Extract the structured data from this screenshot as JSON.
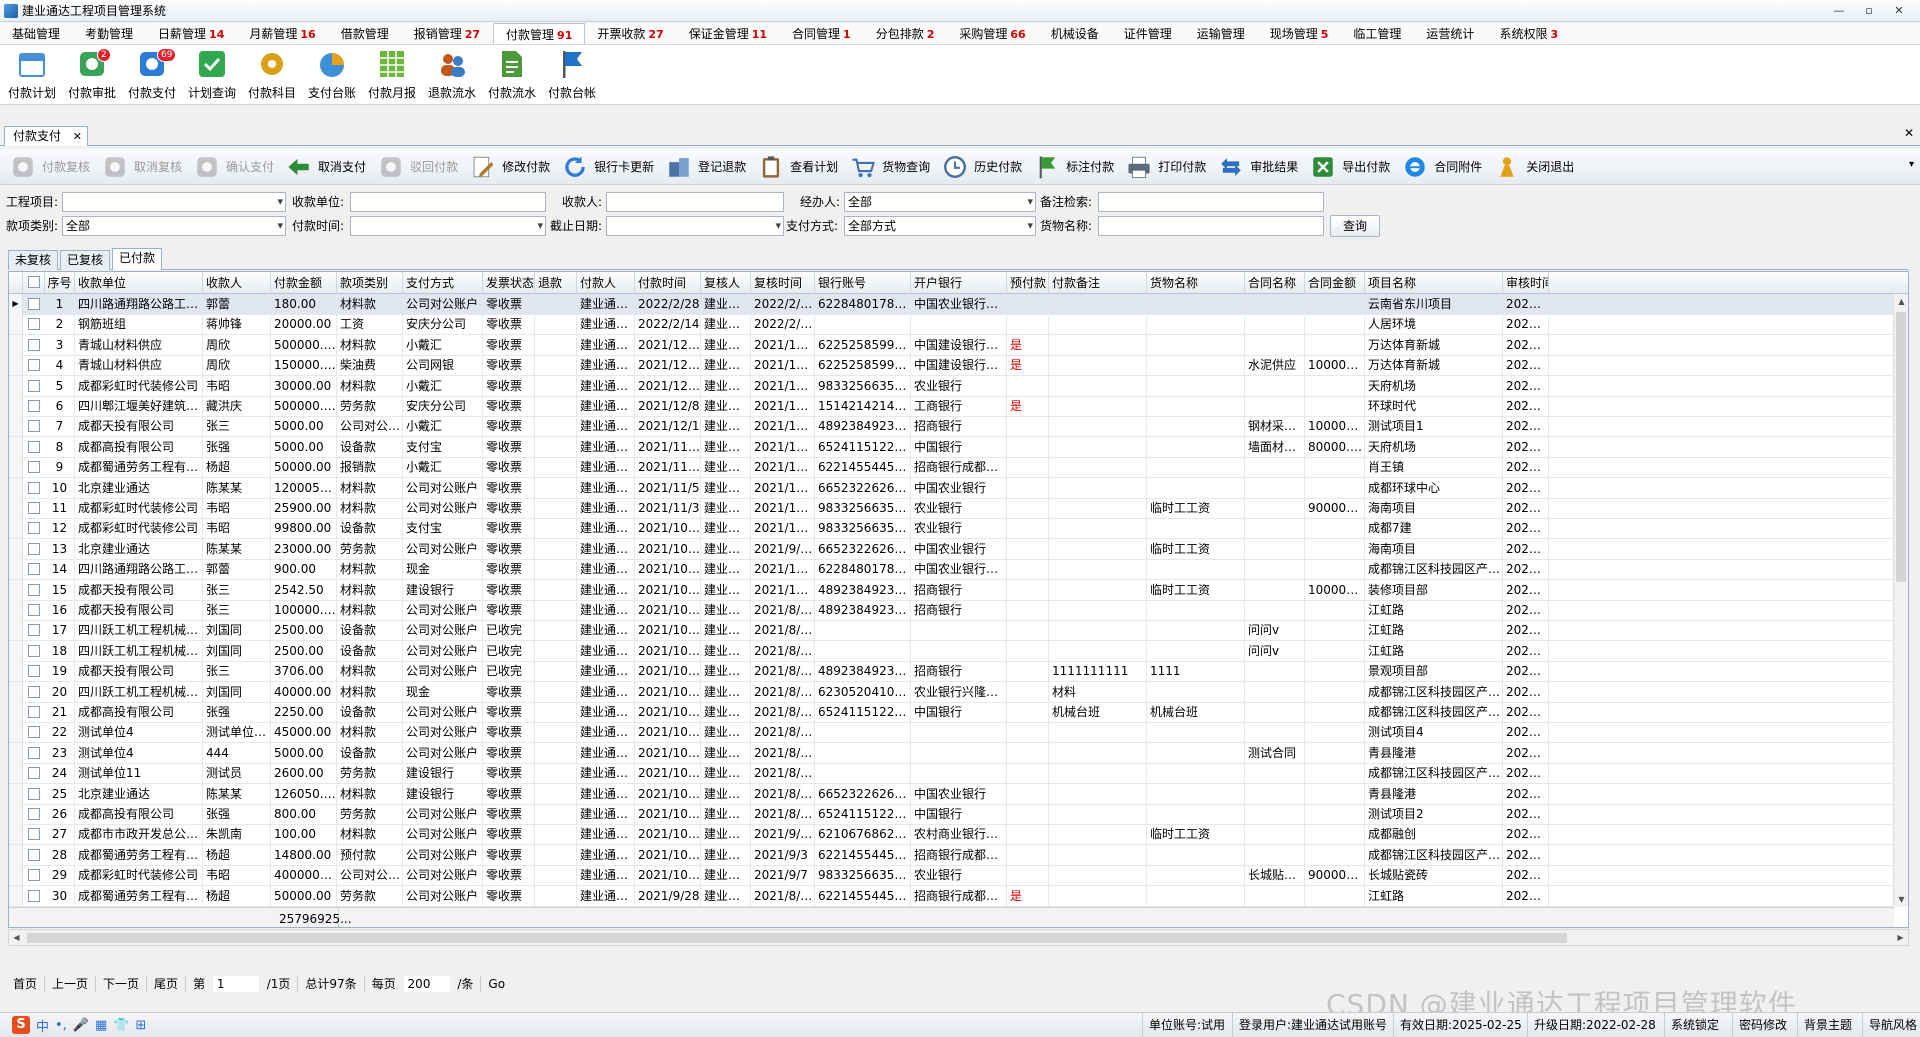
{
  "app": {
    "title": "建业通达工程项目管理系统"
  },
  "window_buttons": [
    "—",
    "▫",
    "✕"
  ],
  "menu": [
    {
      "label": "基础管理",
      "badge": ""
    },
    {
      "label": "考勤管理",
      "badge": ""
    },
    {
      "label": "日薪管理",
      "badge": "14"
    },
    {
      "label": "月薪管理",
      "badge": "16"
    },
    {
      "label": "借款管理",
      "badge": ""
    },
    {
      "label": "报销管理",
      "badge": "27"
    },
    {
      "label": "付款管理",
      "badge": "91"
    },
    {
      "label": "开票收款",
      "badge": "27"
    },
    {
      "label": "保证金管理",
      "badge": "11"
    },
    {
      "label": "合同管理",
      "badge": "1"
    },
    {
      "label": "分包排款",
      "badge": "2"
    },
    {
      "label": "采购管理",
      "badge": "66"
    },
    {
      "label": "机械设备",
      "badge": ""
    },
    {
      "label": "证件管理",
      "badge": ""
    },
    {
      "label": "运输管理",
      "badge": ""
    },
    {
      "label": "现场管理",
      "badge": "5"
    },
    {
      "label": "临工管理",
      "badge": ""
    },
    {
      "label": "运营统计",
      "badge": ""
    },
    {
      "label": "系统权限",
      "badge": "3"
    }
  ],
  "ribbon": [
    {
      "label": "付款计划",
      "icon": "calendar-icon",
      "color": "#4a90d9",
      "badge": ""
    },
    {
      "label": "付款审批",
      "icon": "approve-icon",
      "color": "#3aa35a",
      "badge": "2"
    },
    {
      "label": "付款支付",
      "icon": "pay-icon",
      "color": "#2e7bd6",
      "badge": "69"
    },
    {
      "label": "计划查询",
      "icon": "check-icon",
      "color": "#2fa84f",
      "badge": ""
    },
    {
      "label": "付款科目",
      "icon": "gear-icon",
      "color": "#d9a21b",
      "badge": ""
    },
    {
      "label": "支付台账",
      "icon": "pie-icon",
      "color": "#e4a11b",
      "badge": ""
    },
    {
      "label": "付款月报",
      "icon": "grid-report-icon",
      "color": "#6fb63c",
      "badge": ""
    },
    {
      "label": "退款流水",
      "icon": "users-icon",
      "color": "#c2571a",
      "badge": ""
    },
    {
      "label": "付款流水",
      "icon": "document-icon",
      "color": "#4d9a3a",
      "badge": ""
    },
    {
      "label": "付款台帐",
      "icon": "flag-icon",
      "color": "#1e73c8",
      "badge": ""
    }
  ],
  "doc_tab": {
    "label": "付款支付",
    "close": "✕"
  },
  "close_all": "✕",
  "toolbar": [
    {
      "label": "付款复核",
      "icon": "check-doc-icon",
      "color": "#7a8a9a",
      "disabled": true
    },
    {
      "label": "取消复核",
      "icon": "undo-icon",
      "color": "#7a8a9a",
      "disabled": true
    },
    {
      "label": "确认支付",
      "icon": "upload-icon",
      "color": "#7a8a9a",
      "disabled": true
    },
    {
      "label": "取消支付",
      "icon": "arrow-back-icon",
      "color": "#2e8b3a",
      "disabled": false
    },
    {
      "label": "驳回付款",
      "icon": "reject-icon",
      "color": "#7a8a9a",
      "disabled": true
    },
    {
      "label": "修改付款",
      "icon": "edit-icon",
      "color": "#b07a2a",
      "disabled": false
    },
    {
      "label": "银行卡更新",
      "icon": "refresh-icon",
      "color": "#2e7bd6",
      "disabled": false
    },
    {
      "label": "登记退款",
      "icon": "building-icon",
      "color": "#4a74a8",
      "disabled": false
    },
    {
      "label": "查看计划",
      "icon": "clipboard-icon",
      "color": "#8b6a3a",
      "disabled": false
    },
    {
      "label": "货物查询",
      "icon": "cart-icon",
      "color": "#3f6fae",
      "disabled": false
    },
    {
      "label": "历史付款",
      "icon": "clock-icon",
      "color": "#4a6fa0",
      "disabled": false
    },
    {
      "label": "标注付款",
      "icon": "flag-icon",
      "color": "#3a9a3a",
      "disabled": false
    },
    {
      "label": "打印付款",
      "icon": "printer-icon",
      "color": "#5a6a7a",
      "disabled": false
    },
    {
      "label": "审批结果",
      "icon": "swap-icon",
      "color": "#2e6fc0",
      "disabled": false
    },
    {
      "label": "导出付款",
      "icon": "excel-icon",
      "color": "#2e8b3a",
      "disabled": false
    },
    {
      "label": "合同附件",
      "icon": "ie-icon",
      "color": "#1e88e5",
      "disabled": false
    },
    {
      "label": "关闭退出",
      "icon": "exit-icon",
      "color": "#e0a11b",
      "disabled": false
    }
  ],
  "filters": {
    "project_label": "工程项目:",
    "project_value": "",
    "payee_unit_label": "收款单位:",
    "payee_unit_value": "",
    "payee_label": "收款人:",
    "payee_value": "",
    "handler_label": "经办人:",
    "handler_value": "全部",
    "remark_label": "备注检索:",
    "remark_value": "",
    "category_label": "款项类别:",
    "category_value": "全部",
    "pay_time_label": "付款时间:",
    "pay_time_value": "",
    "deadline_label": "截止日期:",
    "deadline_value": "",
    "pay_method_label": "支付方式:",
    "pay_method_value": "全部方式",
    "goods_label": "货物名称:",
    "goods_value": "",
    "query_button": "查询"
  },
  "sub_tabs": [
    "未复核",
    "已复核",
    "已付款"
  ],
  "table": {
    "headers": [
      "序号",
      "收款单位",
      "收款人",
      "付款金额",
      "款项类别",
      "支付方式",
      "发票状态",
      "退款",
      "付款人",
      "付款时间",
      "复核人",
      "复核时间",
      "银行账号",
      "开户银行",
      "预付款",
      "付款备注",
      "货物名称",
      "合同名称",
      "合同金额",
      "项目名称",
      "审核时间"
    ],
    "rows": [
      [
        "1",
        "四川路通翔路公路工程有...",
        "郭蕾",
        "180.00",
        "材料款",
        "公司对公账户",
        "零收票",
        "",
        "建业通达...",
        "2022/2/28",
        "建业通...",
        "2022/2/28",
        "6228480178540...",
        "中国农业银行金阳...",
        "",
        "",
        "",
        "",
        "",
        "云南省东川项目",
        "2022/2"
      ],
      [
        "2",
        "钢筋班组",
        "蒋帅锋",
        "20000.00",
        "工资",
        "安庆分公司",
        "零收票",
        "",
        "建业通达...",
        "2022/2/14",
        "建业通...",
        "2022/2/14",
        "",
        "",
        "",
        "",
        "",
        "",
        "",
        "人居环境",
        "2022/2"
      ],
      [
        "3",
        "青城山材料供应",
        "周欣",
        "500000.00",
        "材料款",
        "小戴汇",
        "零收票",
        "",
        "建业通达...",
        "2021/12/18",
        "建业通...",
        "2021/12/18",
        "6225258599954...",
        "中国建设银行股份...",
        "是",
        "",
        "",
        "",
        "",
        "万达体育新城",
        "2021/1"
      ],
      [
        "4",
        "青城山材料供应",
        "周欣",
        "150000.00",
        "柴油费",
        "公司网银",
        "零收票",
        "",
        "建业通达...",
        "2021/12/17",
        "建业通...",
        "2021/12/17",
        "6225258599954...",
        "中国建设银行股份...",
        "是",
        "",
        "",
        "水泥供应",
        "100000.00",
        "万达体育新城",
        "2021/1"
      ],
      [
        "5",
        "成都彩虹时代装修公司",
        "韦昭",
        "30000.00",
        "材料款",
        "小戴汇",
        "零收票",
        "",
        "建业通达...",
        "2021/12/14",
        "建业通...",
        "2021/12/14",
        "9833256635552...",
        "农业银行",
        "",
        "",
        "",
        "",
        "",
        "天府机场",
        "2021/1"
      ],
      [
        "6",
        "四川郫江堰美好建筑有限...",
        "藏洪庆",
        "500000.00",
        "劳务款",
        "安庆分公司",
        "零收票",
        "",
        "建业通达...",
        "2021/12/8",
        "建业通...",
        "2021/12/8",
        "1514214214215...",
        "工商银行",
        "是",
        "",
        "",
        "",
        "",
        "环球时代",
        "2021/1"
      ],
      [
        "7",
        "成都天投有限公司",
        "张三",
        "5000.00",
        "公司对公账户",
        "小戴汇",
        "零收票",
        "",
        "建业通达...",
        "2021/12/1",
        "建业通...",
        "2021/12/1",
        "489238492353453",
        "招商银行",
        "",
        "",
        "",
        "钢材采购...",
        "1000000...",
        "测试项目1",
        "2021/1"
      ],
      [
        "8",
        "成都高投有限公司",
        "张强",
        "5000.00",
        "设备款",
        "支付宝",
        "零收票",
        "",
        "建业通达...",
        "2021/11/23",
        "建业通...",
        "2021/11/23",
        "6524115122411...",
        "中国银行",
        "",
        "",
        "",
        "墙面材料...",
        "80000.00",
        "天府机场",
        "2021/1"
      ],
      [
        "9",
        "成都蜀通劳务工程有限公司",
        "杨超",
        "50000.00",
        "报销款",
        "小戴汇",
        "零收票",
        "",
        "建业通达...",
        "2021/11/20",
        "建业通...",
        "2021/11/20",
        "6221455445454...",
        "招商银行成都天府...",
        "",
        "",
        "",
        "",
        "",
        "肖王镇",
        "2021/1"
      ],
      [
        "10",
        "北京建业通达",
        "陈某某",
        "1200050.00",
        "材料款",
        "公司对公账户",
        "零收票",
        "",
        "建业通达...",
        "2021/11/5",
        "建业通...",
        "2021/11/5",
        "66523226262621",
        "中国农业银行",
        "",
        "",
        "",
        "",
        "",
        "成都环球中心",
        "2021/1"
      ],
      [
        "11",
        "成都彩虹时代装修公司",
        "韦昭",
        "25900.00",
        "材料款",
        "公司对公账户",
        "零收票",
        "",
        "建业通达...",
        "2021/11/3",
        "建业通...",
        "2021/11/3",
        "9833256635552...",
        "农业银行",
        "",
        "",
        "临时工工资",
        "",
        "9000000...",
        "海南项目",
        "2021/1"
      ],
      [
        "12",
        "成都彩虹时代装修公司",
        "韦昭",
        "99800.00",
        "设备款",
        "支付宝",
        "零收票",
        "",
        "建业通达...",
        "2021/10/29",
        "建业通...",
        "2021/10/29",
        "9833256635552...",
        "农业银行",
        "",
        "",
        "",
        "",
        "",
        "成都7建",
        "2021/1"
      ],
      [
        "13",
        "北京建业通达",
        "陈某某",
        "23000.00",
        "劳务款",
        "公司对公账户",
        "零收票",
        "",
        "建业通达...",
        "2021/10/13",
        "建业通...",
        "2021/9/22",
        "66523226262621",
        "中国农业银行",
        "",
        "",
        "临时工工资",
        "",
        "",
        "海南项目",
        "2021/9"
      ],
      [
        "14",
        "四川路通翔路公路工程有...",
        "郭蕾",
        "900.00",
        "材料款",
        "现金",
        "零收票",
        "",
        "建业通达...",
        "2021/10/13",
        "建业通...",
        "2021/10/13",
        "6228480178540...",
        "中国农业银行金阳...",
        "",
        "",
        "",
        "",
        "",
        "成都锦江区科技园区产业基...",
        "2021/1"
      ],
      [
        "15",
        "成都天投有限公司",
        "张三",
        "2542.50",
        "材料款",
        "建设银行",
        "零收票",
        "",
        "建业通达...",
        "2021/10/13",
        "建业通...",
        "2021/10/13",
        "489238492353453",
        "招商银行",
        "",
        "",
        "临时工工资",
        "",
        "1000000...",
        "装修项目部",
        "2021/1"
      ],
      [
        "16",
        "成都天投有限公司",
        "张三",
        "100000.00",
        "材料款",
        "公司对公账户",
        "零收票",
        "",
        "建业通达...",
        "2021/10/13",
        "建业通...",
        "2021/8/24",
        "489238492353453",
        "招商银行",
        "",
        "",
        "",
        "",
        "",
        "江虹路",
        "2021/8"
      ],
      [
        "17",
        "四川跃工机工程机械股份...",
        "刘国同",
        "2500.00",
        "设备款",
        "公司对公账户",
        "已收完",
        "",
        "建业通达...",
        "2021/10/13",
        "建业通...",
        "2021/8/24",
        "",
        "",
        "",
        "",
        "",
        "问问v",
        "",
        "江虹路",
        "2021/1"
      ],
      [
        "18",
        "四川跃工机工程机械股份...",
        "刘国同",
        "2500.00",
        "设备款",
        "公司对公账户",
        "已收完",
        "",
        "建业通达...",
        "2021/10/13",
        "建业通...",
        "2021/8/24",
        "",
        "",
        "",
        "",
        "",
        "问问v",
        "",
        "江虹路",
        "2021/1"
      ],
      [
        "19",
        "成都天投有限公司",
        "张三",
        "3706.00",
        "材料款",
        "公司对公账户",
        "已收完",
        "",
        "建业通达...",
        "2021/10/13",
        "建业通...",
        "2021/8/24",
        "489238492353453",
        "招商银行",
        "",
        "1111111111",
        "1111",
        "",
        "",
        "景观项目部",
        "2021/1"
      ],
      [
        "20",
        "四川跃工机工程机械股份...",
        "刘国同",
        "40000.00",
        "材料款",
        "现金",
        "零收票",
        "",
        "建业通达...",
        "2021/10/13",
        "建业通...",
        "2021/8/24",
        "6230520410060...",
        "农业银行兴隆湖支行",
        "",
        "材料",
        "",
        "",
        "",
        "成都锦江区科技园区产业基...",
        "2021/1"
      ],
      [
        "21",
        "成都高投有限公司",
        "张强",
        "2250.00",
        "设备款",
        "公司对公账户",
        "零收票",
        "",
        "建业通达...",
        "2021/10/13",
        "建业通...",
        "2021/8/25",
        "6524115122411...",
        "中国银行",
        "",
        "机械台班",
        "机械台班",
        "",
        "",
        "成都锦江区科技园区产业基...",
        "2021/1"
      ],
      [
        "22",
        "测试单位4",
        "测试单位4...",
        "45000.00",
        "材料款",
        "公司对公账户",
        "零收票",
        "",
        "建业通达...",
        "2021/10/13",
        "建业通...",
        "2021/8/24",
        "",
        "",
        "",
        "",
        "",
        "",
        "",
        "测试项目4",
        "2021/1"
      ],
      [
        "23",
        "测试单位4",
        "444",
        "5000.00",
        "设备款",
        "公司对公账户",
        "零收票",
        "",
        "建业通达...",
        "2021/10/13",
        "建业通...",
        "2021/8/27",
        "",
        "",
        "",
        "",
        "",
        "测试合同",
        "",
        "青县隆港",
        "2021/1"
      ],
      [
        "24",
        "测试单位11",
        "测试员",
        "2600.00",
        "劳务款",
        "建设银行",
        "零收票",
        "",
        "建业通达...",
        "2021/10/13",
        "建业通...",
        "2021/8/27",
        "",
        "",
        "",
        "",
        "",
        "",
        "",
        "成都锦江区科技园区产业基...",
        "2021/1"
      ],
      [
        "25",
        "北京建业通达",
        "陈某某",
        "126050.00",
        "材料款",
        "建设银行",
        "零收票",
        "",
        "建业通达...",
        "2021/10/13",
        "建业通...",
        "2021/8/27",
        "66523226262621",
        "中国农业银行",
        "",
        "",
        "",
        "",
        "",
        "青县隆港",
        "2021/1"
      ],
      [
        "26",
        "成都高投有限公司",
        "张强",
        "800.00",
        "劳务款",
        "公司对公账户",
        "零收票",
        "",
        "建业通达...",
        "2021/10/13",
        "建业通...",
        "2021/8/27",
        "6524115122411...",
        "中国银行",
        "",
        "",
        "",
        "",
        "",
        "测试项目2",
        "2021/1"
      ],
      [
        "27",
        "成都市市政开发总公司机...",
        "朱凯南",
        "100.00",
        "材料款",
        "公司对公账户",
        "零收票",
        "",
        "建业通达...",
        "2021/10/13",
        "建业通...",
        "2021/9/29",
        "6210676862259...",
        "农村商业银行太平...",
        "",
        "",
        "临时工工资",
        "",
        "",
        "成都融创",
        "2021/1"
      ],
      [
        "28",
        "成都蜀通劳务工程有限公司",
        "杨超",
        "14800.00",
        "预付款",
        "公司对公账户",
        "零收票",
        "",
        "建业通达...",
        "2021/10/13",
        "建业通...",
        "2021/9/3",
        "6221455445454...",
        "招商银行成都天府...",
        "",
        "",
        "",
        "",
        "",
        "成都锦江区科技园区产业基...",
        "2021/1"
      ],
      [
        "29",
        "成都彩虹时代装修公司",
        "韦昭",
        "4000000.00",
        "公司对公账户",
        "公司对公账户",
        "零收票",
        "",
        "建业通达...",
        "2021/10/13",
        "建业通...",
        "2021/9/7",
        "9833256635552...",
        "农业银行",
        "",
        "",
        "",
        "长城贴瓷砖",
        "9000000...",
        "长城贴瓷砖",
        "2021/1"
      ],
      [
        "30",
        "成都蜀通劳务工程有限公司",
        "杨超",
        "50000.00",
        "劳务款",
        "公司对公账户",
        "零收票",
        "",
        "建业通达...",
        "2021/9/28",
        "建业通...",
        "2021/8/25",
        "6221455445454...",
        "招商银行成都天府...",
        "是",
        "",
        "",
        "",
        "",
        "江虹路",
        "2021/8"
      ]
    ],
    "total_amount": "25796925..."
  },
  "pager": {
    "first": "首页",
    "prev": "上一页",
    "next": "下一页",
    "last": "尾页",
    "page_prefix": "第",
    "page_value": "1",
    "page_suffix": "/1页",
    "total": "总计97条",
    "per_page_prefix": "每页",
    "per_page_value": "200",
    "per_page_suffix": "/条",
    "go": "Go"
  },
  "status": {
    "ime": [
      "中",
      "•,",
      "🎤",
      "▦",
      "👕",
      "⊞"
    ],
    "unit": "单位账号:试用",
    "user": "登录用户:建业通达试用账号",
    "valid": "有效日期:2025-02-25",
    "upgrade": "升级日期:2022-02-28",
    "lock": "系统锁定",
    "password": "密码修改",
    "theme": "背景主题",
    "nav": "导航风格"
  },
  "watermark": "CSDN @建业通达工程项目管理软件"
}
